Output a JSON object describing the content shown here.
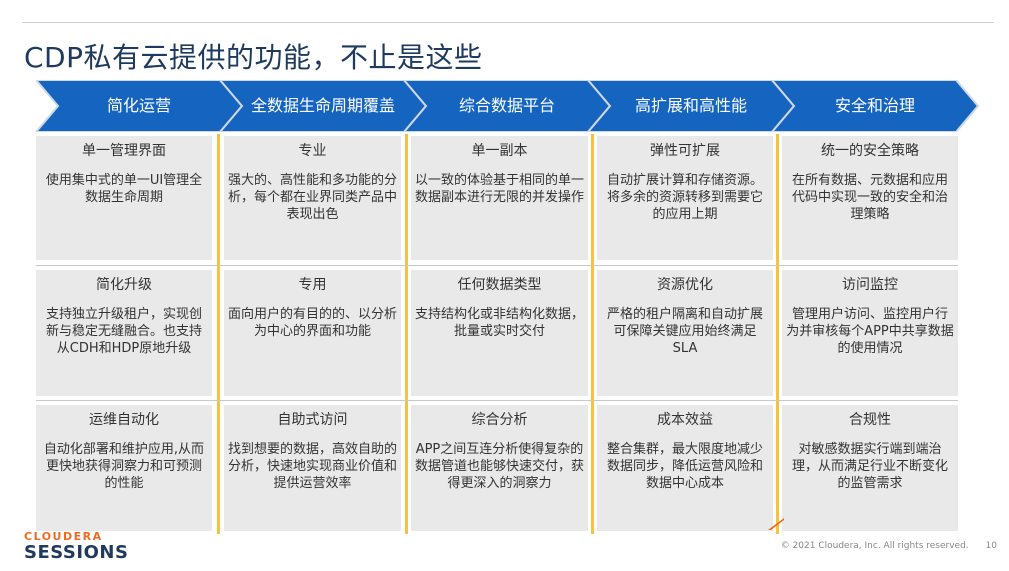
{
  "title": "CDP私有云提供的功能，不止是这些",
  "colors": {
    "chevron": "#1565c0",
    "chevron_border": "#cfd8e3",
    "divider": "#f5c242",
    "cell_bg": "#e9e9e9",
    "title": "#1e3a5f"
  },
  "columns": [
    {
      "header": "简化运营",
      "cells": [
        {
          "title": "单一管理界面",
          "desc": "使用集中式的单一UI管理全数据生命周期"
        },
        {
          "title": "简化升级",
          "desc": "支持独立升级租户，实现创新与稳定无缝融合。也支持从CDH和HDP原地升级"
        },
        {
          "title": "运维自动化",
          "desc": "自动化部署和维护应用,从而更快地获得洞察力和可预测的性能"
        }
      ]
    },
    {
      "header": "全数据生命周期覆盖",
      "cells": [
        {
          "title": "专业",
          "desc": "强大的、高性能和多功能的分析，每个都在业界同类产品中表现出色"
        },
        {
          "title": "专用",
          "desc": "面向用户的有目的的、以分析为中心的界面和功能"
        },
        {
          "title": "自助式访问",
          "desc": "找到想要的数据，高效自助的分析，快速地实现商业价值和提供运营效率"
        }
      ]
    },
    {
      "header": "综合数据平台",
      "cells": [
        {
          "title": "单一副本",
          "desc": "以一致的体验基于相同的单一数据副本进行无限的并发操作"
        },
        {
          "title": "任何数据类型",
          "desc": "支持结构化或非结构化数据，批量或实时交付"
        },
        {
          "title": "综合分析",
          "desc": "APP之间互连分析使得复杂的数据管道也能够快速交付，获得更深入的洞察力"
        }
      ]
    },
    {
      "header": "高扩展和高性能",
      "cells": [
        {
          "title": "弹性可扩展",
          "desc": "自动扩展计算和存储资源。 将多余的资源转移到需要它的应用上期"
        },
        {
          "title": "资源优化",
          "desc": "严格的租户隔离和自动扩展可保障关键应用始终满足 SLA"
        },
        {
          "title": "成本效益",
          "desc": "整合集群，最大限度地减少数据同步，降低运营风险和数据中心成本"
        }
      ]
    },
    {
      "header": "安全和治理",
      "cells": [
        {
          "title": "统一的安全策略",
          "desc": "在所有数据、元数据和应用代码中实现一致的安全和治理策略"
        },
        {
          "title": "访问监控",
          "desc": "管理用户访问、监控用户行为并审核每个APP中共享数据的使用情况"
        },
        {
          "title": "合规性",
          "desc": "对敏感数据实行端到端治理，从而满足行业不断变化的监管需求"
        }
      ]
    }
  ],
  "footer": {
    "logo_top": "CLOUDERA",
    "logo_bottom": "SESSIONS",
    "copyright": "© 2021 Cloudera, Inc. All rights reserved.",
    "page_number": "10"
  }
}
